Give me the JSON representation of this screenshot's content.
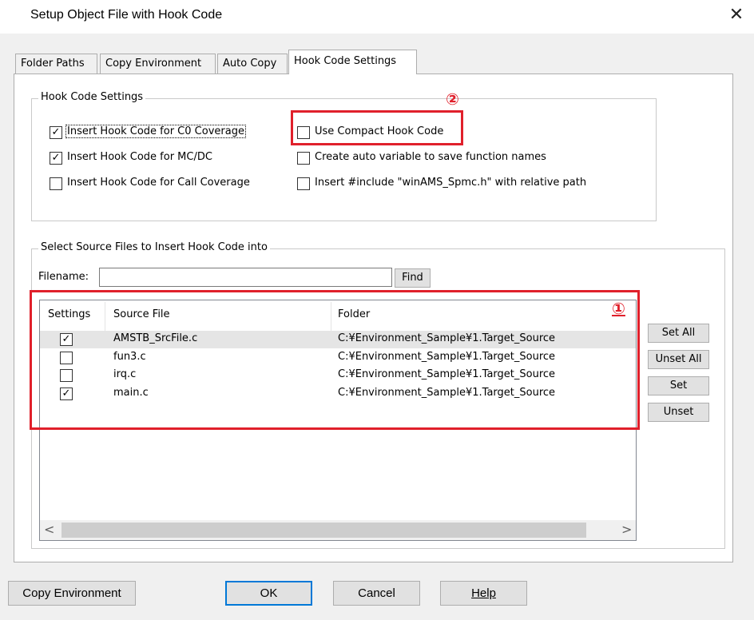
{
  "window": {
    "title": "Setup Object File with Hook Code",
    "close_glyph": "✕"
  },
  "tabs": [
    {
      "label": "Folder Paths"
    },
    {
      "label": "Copy Environment"
    },
    {
      "label": "Auto Copy"
    },
    {
      "label": "Hook Code Settings"
    }
  ],
  "hook_group": {
    "title": "Hook Code Settings",
    "options": [
      {
        "label": "Insert Hook Code for C0 Coverage",
        "checked": true
      },
      {
        "label": "Insert Hook Code for MC/DC",
        "checked": true
      },
      {
        "label": "Insert Hook Code for Call Coverage",
        "checked": false
      },
      {
        "label": "Use Compact Hook Code",
        "checked": false
      },
      {
        "label": "Create auto variable to save function names",
        "checked": false
      },
      {
        "label": "Insert #include \"winAMS_Spmc.h\" with relative path",
        "checked": false
      }
    ]
  },
  "source_group": {
    "title": "Select Source Files to Insert Hook Code into",
    "filename_label": "Filename:",
    "filename_value": "",
    "find_label": "Find",
    "columns": [
      "Settings",
      "Source File",
      "Folder"
    ],
    "rows": [
      {
        "checked": true,
        "file": "AMSTB_SrcFile.c",
        "folder": "C:¥Environment_Sample¥1.Target_Source"
      },
      {
        "checked": false,
        "file": "fun3.c",
        "folder": "C:¥Environment_Sample¥1.Target_Source"
      },
      {
        "checked": false,
        "file": "irq.c",
        "folder": "C:¥Environment_Sample¥1.Target_Source"
      },
      {
        "checked": true,
        "file": "main.c",
        "folder": "C:¥Environment_Sample¥1.Target_Source"
      }
    ],
    "side_buttons": [
      "Set All",
      "Unset All",
      "Set",
      "Unset"
    ]
  },
  "annotations": {
    "one": "①",
    "two": "②"
  },
  "footer": {
    "copy_env": "Copy Environment",
    "ok": "OK",
    "cancel": "Cancel",
    "help": "Help"
  },
  "colors": {
    "annotation_red": "#e0202b",
    "focus_blue": "#0078d7"
  }
}
